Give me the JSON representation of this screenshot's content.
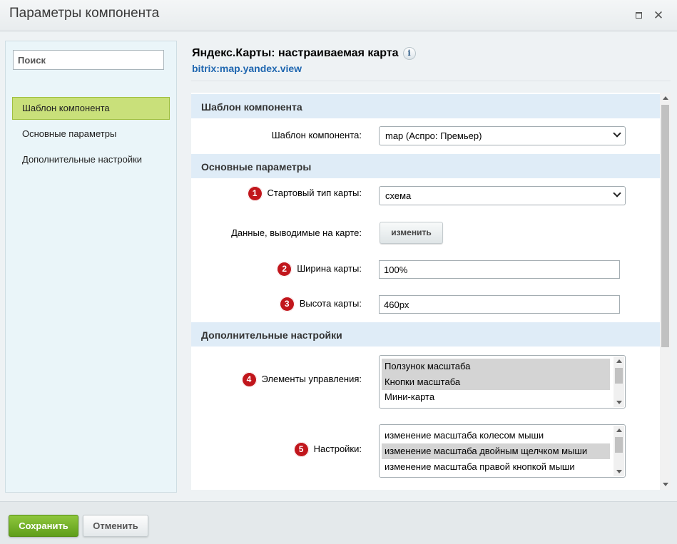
{
  "window": {
    "title": "Параметры компонента"
  },
  "sidebar": {
    "search_placeholder": "Поиск",
    "items": [
      {
        "label": "Шаблон компонента",
        "active": true
      },
      {
        "label": "Основные параметры",
        "active": false
      },
      {
        "label": "Дополнительные настройки",
        "active": false
      }
    ]
  },
  "component": {
    "title": "Яндекс.Карты: настраиваемая карта",
    "code": "bitrix:map.yandex.view",
    "info_icon": "i"
  },
  "sections": {
    "template": {
      "header": "Шаблон компонента",
      "template_label": "Шаблон компонента:",
      "template_value": "map (Аспро: Премьер)"
    },
    "main": {
      "header": "Основные параметры",
      "start_type_badge": "1",
      "start_type_label": "Стартовый тип карты:",
      "start_type_value": "схема",
      "data_label": "Данные, выводимые на карте:",
      "data_button": "изменить",
      "width_badge": "2",
      "width_label": "Ширина карты:",
      "width_value": "100%",
      "height_badge": "3",
      "height_label": "Высота карты:",
      "height_value": "460px"
    },
    "extra": {
      "header": "Дополнительные настройки",
      "controls_badge": "4",
      "controls_label": "Элементы управления:",
      "controls_options": [
        {
          "label": "Ползунок масштаба",
          "selected": true
        },
        {
          "label": "Кнопки масштаба",
          "selected": true
        },
        {
          "label": "Мини-карта",
          "selected": false
        }
      ],
      "settings_badge": "5",
      "settings_label": "Настройки:",
      "settings_options": [
        {
          "label": "изменение масштаба колесом мыши",
          "selected": false
        },
        {
          "label": "изменение масштаба двойным щелчком мыши",
          "selected": true
        },
        {
          "label": "изменение масштаба правой кнопкой мыши",
          "selected": false
        }
      ]
    }
  },
  "footer": {
    "save_label": "Сохранить",
    "cancel_label": "Отменить"
  },
  "colors": {
    "accent_green": "#6aab22",
    "active_nav": "#c9e07a",
    "section_bg": "#dfecf7",
    "badge_red": "#c1161c",
    "link_blue": "#2067b0"
  }
}
